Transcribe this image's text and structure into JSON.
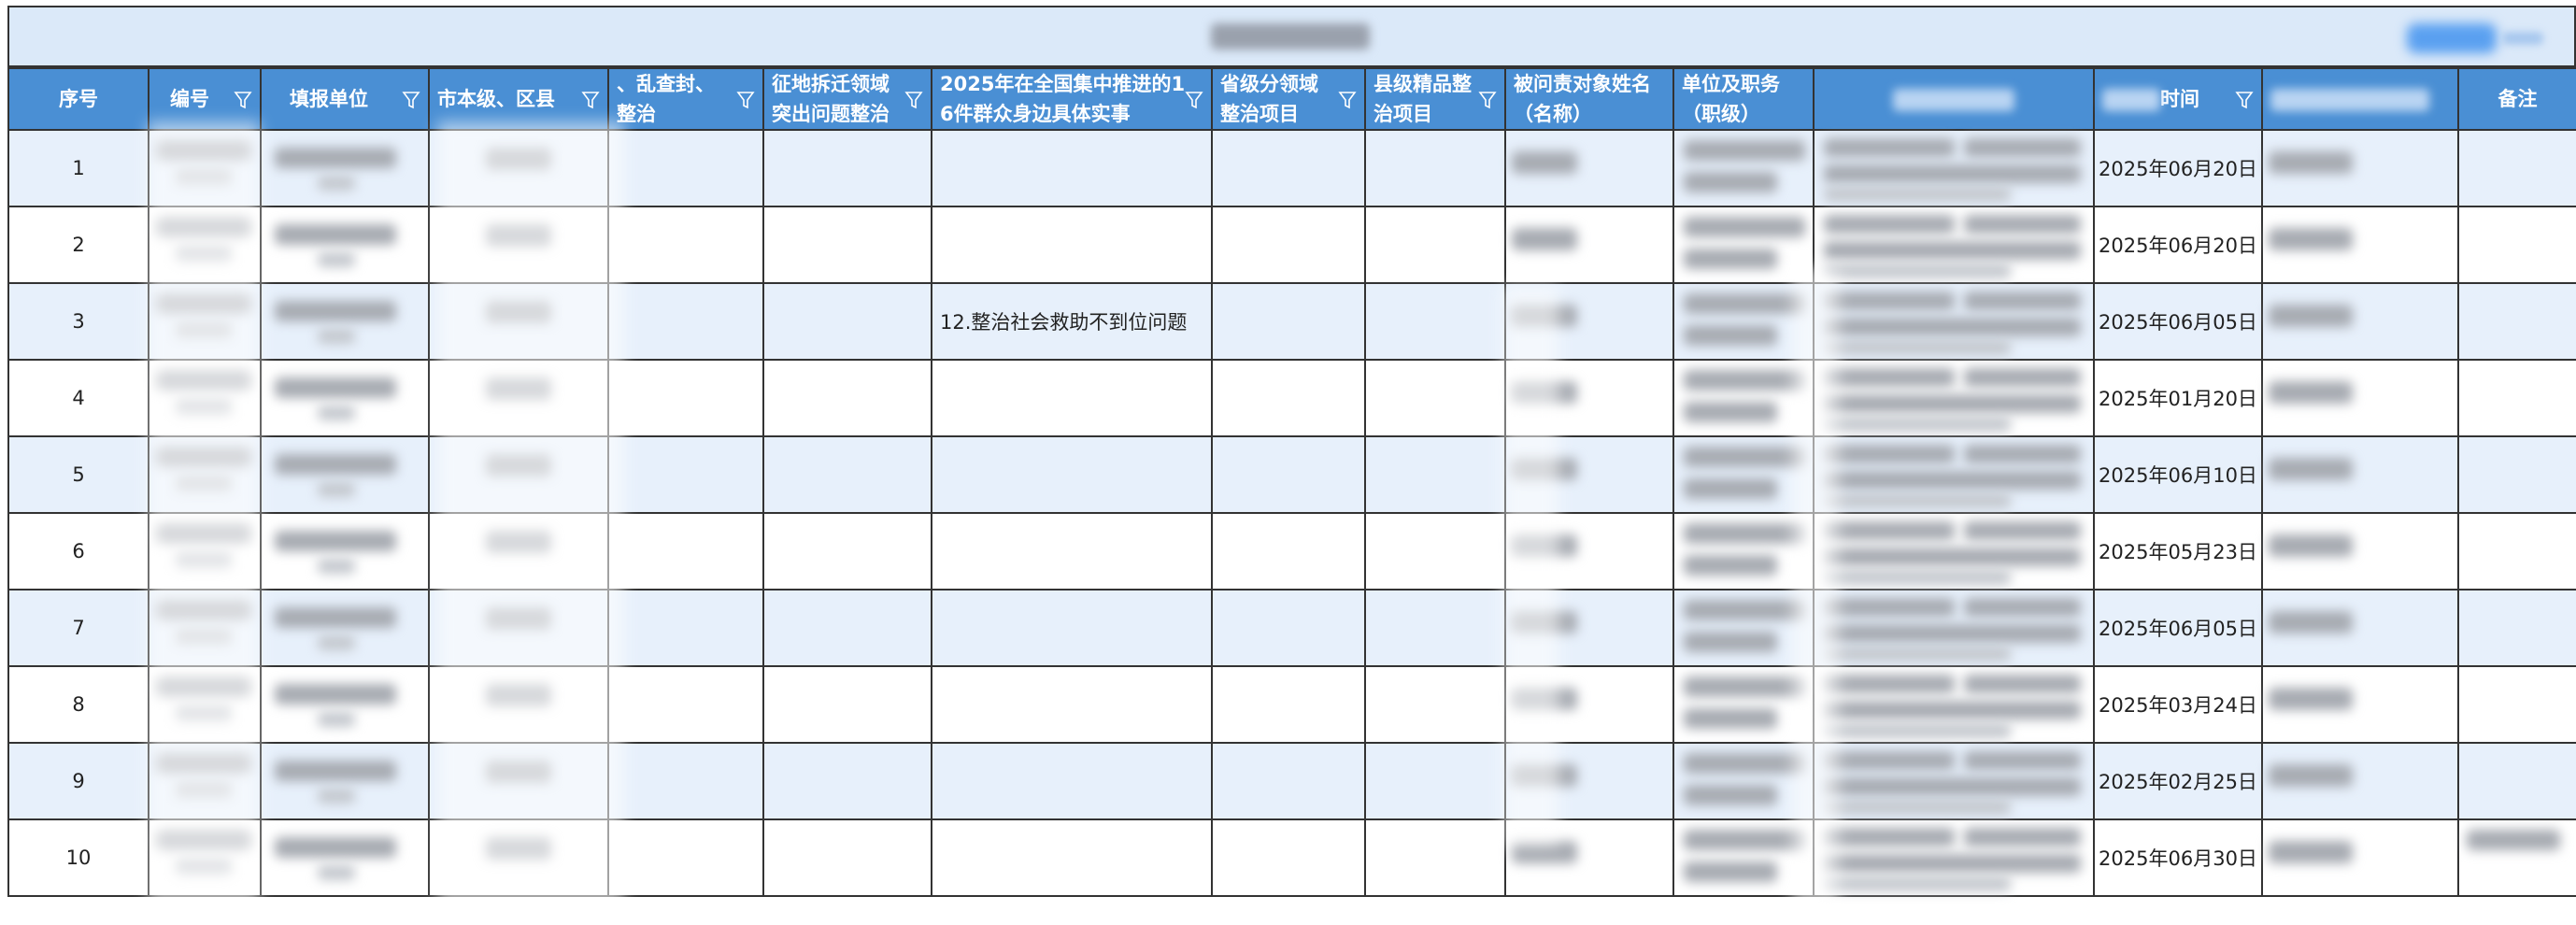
{
  "header": {
    "col_seq": "序号",
    "col_code": "编号",
    "col_unit": "填报单位",
    "col_district": "市本级、区县",
    "col_cut_line1": "、乱查封、",
    "col_cut_line2": "整治",
    "col_land_line1": "征地拆迁领域",
    "col_land_line2": "突出问题整治",
    "col_issue_line1": "2025年在全国集中推进的1",
    "col_issue_line2": "6件群众身边具体实事",
    "col_prov_line1": "省级分领域",
    "col_prov_line2": "整治项目",
    "col_county_line1": "县级精品整",
    "col_county_line2": "治项目",
    "col_name_line1": "被问责对象姓名",
    "col_name_line2": "（名称）",
    "col_post_line1": "单位及职务",
    "col_post_line2": "（职级）",
    "col_time_suffix": "时间",
    "col_remark": "备注"
  },
  "rows": [
    {
      "seq": "1",
      "issue": "",
      "date": "2025年06月20日"
    },
    {
      "seq": "2",
      "issue": "",
      "date": "2025年06月20日"
    },
    {
      "seq": "3",
      "issue": "12.整治社会救助不到位问题",
      "date": "2025年06月05日"
    },
    {
      "seq": "4",
      "issue": "",
      "date": "2025年01月20日"
    },
    {
      "seq": "5",
      "issue": "",
      "date": "2025年06月10日"
    },
    {
      "seq": "6",
      "issue": "",
      "date": "2025年05月23日"
    },
    {
      "seq": "7",
      "issue": "",
      "date": "2025年06月05日"
    },
    {
      "seq": "8",
      "issue": "",
      "date": "2025年03月24日"
    },
    {
      "seq": "9",
      "issue": "",
      "date": "2025年02月25日"
    },
    {
      "seq": "10",
      "issue": "",
      "date": "2025年06月30日"
    }
  ],
  "colors": {
    "header_bg": "#4a8fd4",
    "title_bg": "#dbe9f9",
    "alt_row_bg": "#e7f0fb",
    "border": "#333333"
  }
}
